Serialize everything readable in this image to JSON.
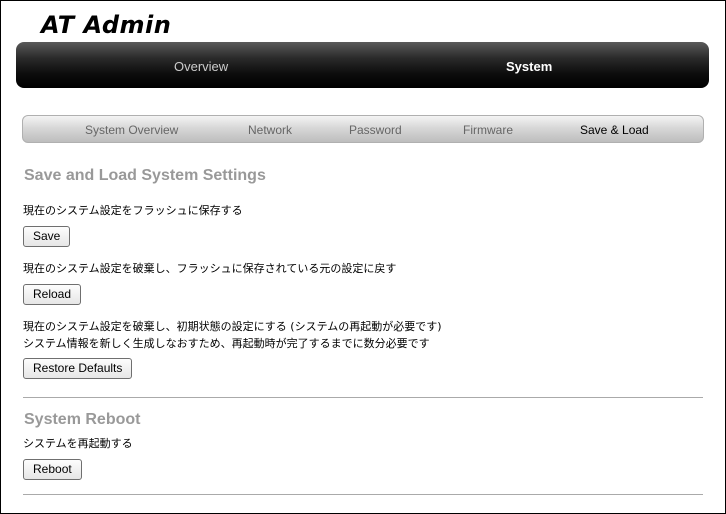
{
  "app": {
    "logo_text": "AT Admin"
  },
  "main_nav": {
    "tabs": [
      {
        "label": "Overview"
      },
      {
        "label": "System"
      }
    ]
  },
  "sub_nav": {
    "tabs": [
      {
        "label": "System Overview"
      },
      {
        "label": "Network"
      },
      {
        "label": "Password"
      },
      {
        "label": "Firmware"
      },
      {
        "label": "Save & Load"
      }
    ]
  },
  "save_load": {
    "heading": "Save and Load System Settings",
    "save_desc": "現在のシステム設定をフラッシュに保存する",
    "save_button": "Save",
    "reload_desc": "現在のシステム設定を破棄し、フラッシュに保存されている元の設定に戻す",
    "reload_button": "Reload",
    "restore_desc_1": "現在のシステム設定を破棄し、初期状態の設定にする (システムの再起動が必要です)",
    "restore_desc_2": "システム情報を新しく生成しなおすため、再起動時が完了するまでに数分必要です",
    "restore_button": "Restore Defaults"
  },
  "reboot": {
    "heading": "System Reboot",
    "desc": "システムを再起動する",
    "button": "Reboot"
  }
}
